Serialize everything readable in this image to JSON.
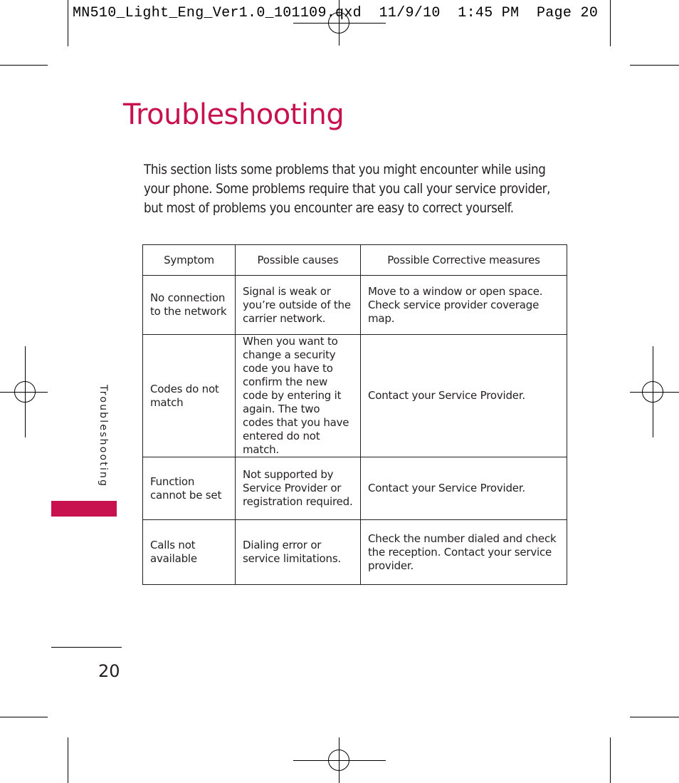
{
  "slug_line": "MN510_Light_Eng_Ver1.0_101109.qxd  11/9/10  1:45 PM  Page 20",
  "title": "Troubleshooting",
  "intro": "This section lists some problems that you might encounter while using your phone. Some problems require that you call your service provider, but most of problems you encounter are easy to correct yourself.",
  "table": {
    "headers": [
      "Symptom",
      "Possible causes",
      "Possible Corrective measures"
    ],
    "rows": [
      {
        "symptom": "No connection to the network",
        "causes": "Signal is weak or you’re outside of the carrier network.",
        "measures": "Move to a window or open space. Check service provider coverage map."
      },
      {
        "symptom": "Codes do not match",
        "causes": "When you want to change a security code you have to confirm the new code by entering it again. The two codes that you have entered do not match.",
        "measures": "Contact your Service Provider."
      },
      {
        "symptom": "Function cannot be set",
        "causes": "Not supported by Service Provider or registration required.",
        "measures": "Contact your Service Provider."
      },
      {
        "symptom": "Calls not available",
        "causes": "Dialing error or service limitations.",
        "measures": "Check the number dialed and check the reception. Contact your service provider."
      }
    ]
  },
  "side_tab": {
    "label": "Troubleshooting",
    "color": "#c8114f"
  },
  "page_number": "20",
  "accent_color": "#c8114f"
}
